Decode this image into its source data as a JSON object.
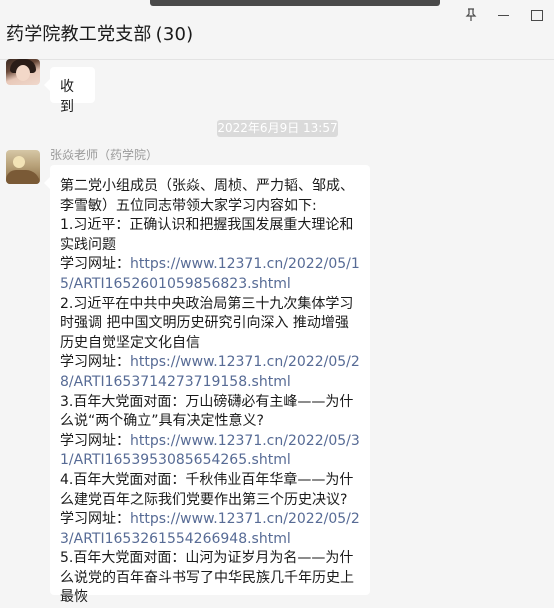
{
  "window": {
    "title": "药学院教工党支部",
    "member_count": "(30)"
  },
  "messages": {
    "first_text": "收到",
    "timestamp": "2022年6月9日 13:57",
    "sender": "张焱老师（药学院）",
    "lines": [
      {
        "type": "text",
        "text": "第二党小组成员（张焱、周桢、严力韬、邹成、李雪敏）五位同志带领大家学习内容如下:"
      },
      {
        "type": "text",
        "text": "1.习近平：正确认识和把握我国发展重大理论和实践问题"
      },
      {
        "type": "link",
        "label": "学习网址：",
        "url": "https://www.12371.cn/2022/05/15/ARTI1652601059856823.shtml"
      },
      {
        "type": "text",
        "text": "2.习近平在中共中央政治局第三十九次集体学习时强调 把中国文明历史研究引向深入 推动增强历史自觉坚定文化自信"
      },
      {
        "type": "link",
        "label": "学习网址：",
        "url": "https://www.12371.cn/2022/05/28/ARTI1653714273719158.shtml"
      },
      {
        "type": "text",
        "text": "3.百年大党面对面：万山磅礴必有主峰——为什么说“两个确立”具有决定性意义?"
      },
      {
        "type": "link",
        "label": "学习网址：",
        "url": "https://www.12371.cn/2022/05/31/ARTI1653953085654265.shtml"
      },
      {
        "type": "text",
        "text": "4.百年大党面对面：千秋伟业百年华章——为什么建党百年之际我们党要作出第三个历史决议?"
      },
      {
        "type": "link",
        "label": "学习网址：",
        "url": "https://www.12371.cn/2022/05/23/ARTI1653261554266948.shtml"
      },
      {
        "type": "text",
        "text": "5.百年大党面对面：山河为证岁月为名——为什么说党的百年奋斗书写了中华民族几千年历史上最恢"
      }
    ]
  }
}
